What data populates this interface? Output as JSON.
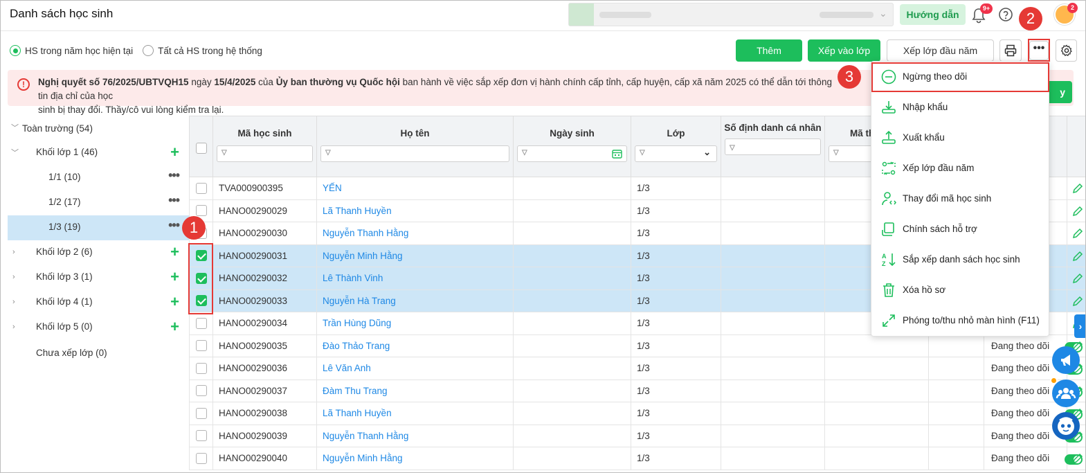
{
  "header": {
    "title": "Danh sách học sinh",
    "guide_label": "Hướng dẫn",
    "notif_badge": "9+",
    "avatar_badge": "2"
  },
  "filter_radio": {
    "current": "HS trong năm học hiện tại",
    "all": "Tất cả HS trong hệ thống"
  },
  "toolbar": {
    "add": "Thêm",
    "assign": "Xếp vào lớp",
    "assign_start": "Xếp lớp đầu năm"
  },
  "alert": {
    "bold1": "Nghị quyết số 76/2025/UBTVQH15",
    "t1": " ngày ",
    "bold2": "15/4/2025",
    "t2": " của ",
    "bold3": "Ủy ban thường vụ Quốc hội",
    "t3": " ban hành về việc sắp xếp đơn vị hành chính cấp tỉnh, cấp huyện, cấp xã năm 2025 có thể dẫn tới thông tin địa chỉ của học",
    "t4": "sinh bị thay đổi. Thầy/cô vui lòng kiểm tra lại."
  },
  "tree": [
    {
      "label": "Toàn trường (54)"
    },
    {
      "label": "Khối lớp 1 (46)"
    },
    {
      "label": "1/1 (10)"
    },
    {
      "label": "1/2 (17)"
    },
    {
      "label": "1/3 (19)"
    },
    {
      "label": "Khối lớp 2 (6)"
    },
    {
      "label": "Khối lớp 3 (1)"
    },
    {
      "label": "Khối lớp 4 (1)"
    },
    {
      "label": "Khối lớp 5 (0)"
    },
    {
      "label": "Chưa xếp lớp (0)"
    }
  ],
  "table": {
    "headers": [
      "Mã học sinh",
      "Họ tên",
      "Ngày sinh",
      "Lớp",
      "Số định danh cá nhân",
      "Mã th"
    ],
    "status_label": "Đang theo dõi",
    "rows": [
      {
        "id": "TVA000900395",
        "name": "YẾN",
        "cls": "1/3",
        "checked": false,
        "status": ""
      },
      {
        "id": "HANO00290029",
        "name": "Lã Thanh Huyền",
        "cls": "1/3",
        "checked": false,
        "status": ""
      },
      {
        "id": "HANO00290030",
        "name": "Nguyễn Thanh Hằng",
        "cls": "1/3",
        "checked": false,
        "status": ""
      },
      {
        "id": "HANO00290031",
        "name": "Nguyễn Minh Hằng",
        "cls": "1/3",
        "checked": true,
        "status": ""
      },
      {
        "id": "HANO00290032",
        "name": "Lê Thành Vinh",
        "cls": "1/3",
        "checked": true,
        "status": ""
      },
      {
        "id": "HANO00290033",
        "name": "Nguyễn Hà Trang",
        "cls": "1/3",
        "checked": true,
        "status": ""
      },
      {
        "id": "HANO00290034",
        "name": "Trần Hùng Dũng",
        "cls": "1/3",
        "checked": false,
        "status": ""
      },
      {
        "id": "HANO00290035",
        "name": "Đào Thảo Trang",
        "cls": "1/3",
        "checked": false,
        "status": "Đang theo dõi"
      },
      {
        "id": "HANO00290036",
        "name": "Lê Văn Anh",
        "cls": "1/3",
        "checked": false,
        "status": "Đang theo dõi"
      },
      {
        "id": "HANO00290037",
        "name": "Đàm Thu Trang",
        "cls": "1/3",
        "checked": false,
        "status": "Đang theo dõi"
      },
      {
        "id": "HANO00290038",
        "name": "Lã Thanh Huyền",
        "cls": "1/3",
        "checked": false,
        "status": "Đang theo dõi"
      },
      {
        "id": "HANO00290039",
        "name": "Nguyễn Thanh Hằng",
        "cls": "1/3",
        "checked": false,
        "status": "Đang theo dõi"
      },
      {
        "id": "HANO00290040",
        "name": "Nguyễn Minh Hằng",
        "cls": "1/3",
        "checked": false,
        "status": "Đang theo dõi"
      }
    ]
  },
  "menu": [
    {
      "label": "Ngừng theo dõi",
      "icon": "minus-circle-icon"
    },
    {
      "label": "Nhập khẩu",
      "icon": "import-icon"
    },
    {
      "label": "Xuất khẩu",
      "icon": "export-icon"
    },
    {
      "label": "Xếp lớp đầu năm",
      "icon": "arrange-class-icon"
    },
    {
      "label": "Thay đổi mã học sinh",
      "icon": "user-code-icon"
    },
    {
      "label": "Chính sách hỗ trợ",
      "icon": "policy-icon"
    },
    {
      "label": "Sắp xếp danh sách học sinh",
      "icon": "sort-az-icon"
    },
    {
      "label": "Xóa hồ sơ",
      "icon": "trash-icon"
    },
    {
      "label": "Phóng to/thu nhỏ màn hình (F11)",
      "icon": "fullscreen-icon"
    }
  ],
  "steps": [
    "1",
    "2",
    "3"
  ],
  "colors": {
    "primary": "#1dbe5c",
    "link": "#1e88e5",
    "highlight": "#e53935",
    "selected_row": "#cde6f7"
  }
}
